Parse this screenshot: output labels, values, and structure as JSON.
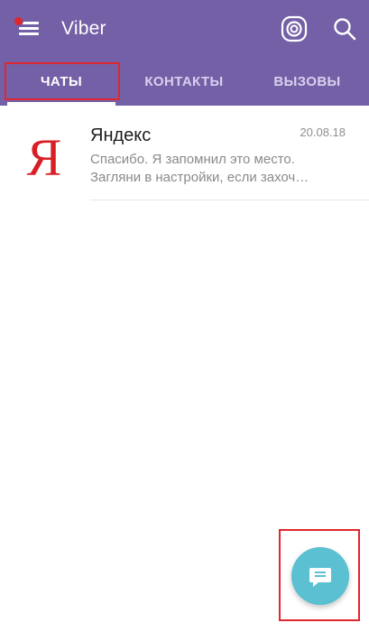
{
  "app": {
    "title": "Viber",
    "accent_color": "#7360a6",
    "fab_color": "#5ac0d2",
    "highlight_color": "#e0262e"
  },
  "header": {
    "menu_icon": "hamburger-menu-icon",
    "menu_has_notification": true,
    "stories_icon": "viber-circle-icon",
    "search_icon": "search-icon"
  },
  "tabs": [
    {
      "label": "ЧАТЫ",
      "active": true
    },
    {
      "label": "КОНТАКТЫ",
      "active": false
    },
    {
      "label": "ВЫЗОВЫ",
      "active": false
    }
  ],
  "chats": [
    {
      "name": "Яндекс",
      "avatar_letter": "Я",
      "date": "20.08.18",
      "preview_line1": "Спасибо. Я запомнил это место.",
      "preview_line2": "Загляни в настройки, если захоч…"
    }
  ],
  "fab": {
    "icon": "new-chat-message-icon"
  }
}
